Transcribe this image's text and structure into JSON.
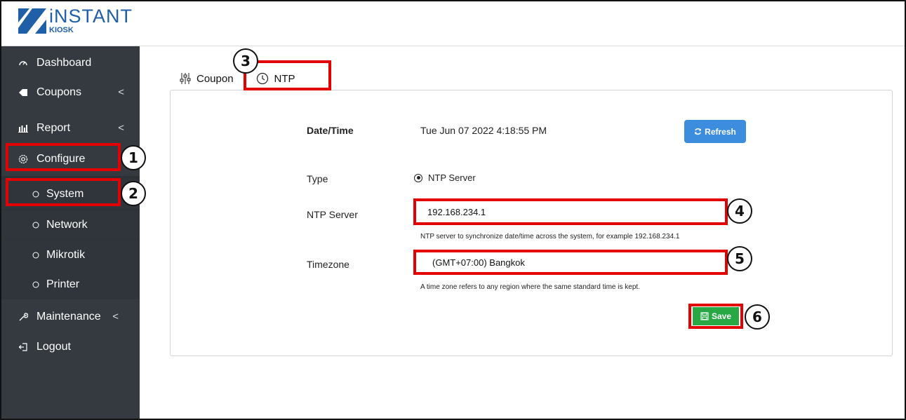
{
  "app": {
    "brand_title": "iNSTANT",
    "brand_sub": "KIOSK"
  },
  "sidebar": {
    "items": [
      {
        "label": "Dashboard",
        "icon": "gauge-icon"
      },
      {
        "label": "Coupons",
        "icon": "tag-icon",
        "caret": "<"
      },
      {
        "label": "Report",
        "icon": "bar-chart-icon",
        "caret": "<"
      },
      {
        "label": "Configure",
        "icon": "gear-icon"
      },
      {
        "label": "System",
        "icon": "circle-icon"
      },
      {
        "label": "Network",
        "icon": "circle-icon"
      },
      {
        "label": "Mikrotik",
        "icon": "circle-icon"
      },
      {
        "label": "Printer",
        "icon": "circle-icon"
      },
      {
        "label": "Maintenance",
        "icon": "wrench-icon",
        "caret": "<"
      },
      {
        "label": "Logout",
        "icon": "logout-icon"
      }
    ]
  },
  "tabs": [
    {
      "label": "Coupon",
      "icon": "sliders-icon"
    },
    {
      "label": "NTP",
      "icon": "clock-icon",
      "active": true
    }
  ],
  "form": {
    "datetime_label": "Date/Time",
    "datetime_value": "Tue Jun 07 2022 4:18:55 PM",
    "refresh_label": "Refresh",
    "type_label": "Type",
    "type_option": "NTP Server",
    "ntp_label": "NTP Server",
    "ntp_value": "192.168.234.1",
    "ntp_hint": "NTP server to synchronize date/time across the system, for example 192.168.234.1",
    "tz_label": "Timezone",
    "tz_value": "(GMT+07:00) Bangkok",
    "tz_hint": "A time zone refers to any region where the same standard time is kept.",
    "save_label": "Save"
  },
  "callouts": [
    "1",
    "2",
    "3",
    "4",
    "5",
    "6"
  ],
  "colors": {
    "sidebar_bg": "#343a40",
    "highlight": "#e20000",
    "refresh_btn": "#3c8dde",
    "save_btn": "#28a745",
    "brand": "#1f5fa8"
  }
}
